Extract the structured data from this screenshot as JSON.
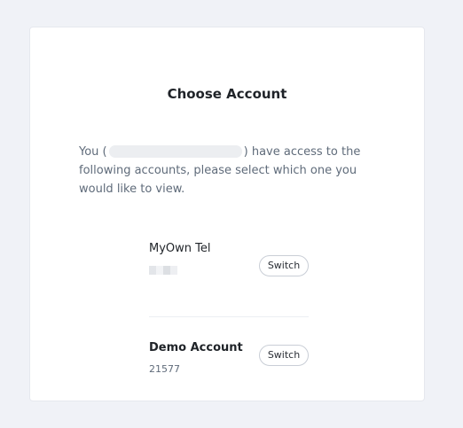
{
  "title": "Choose Account",
  "description": {
    "prefix": "You (",
    "suffix": ") have access to the following accounts, please select which one you would like to view."
  },
  "accounts": [
    {
      "name": "MyOwn Tel",
      "id": "",
      "switch_label": "Switch"
    },
    {
      "name": "Demo Account",
      "id": "21577",
      "switch_label": "Switch"
    }
  ]
}
